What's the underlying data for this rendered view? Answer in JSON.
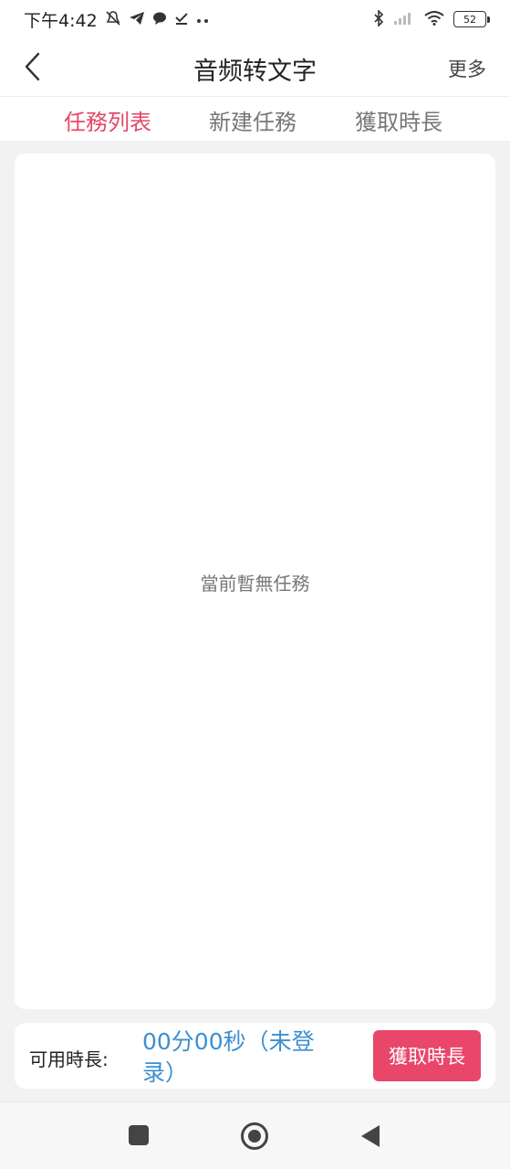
{
  "status_bar": {
    "time": "下午4:42",
    "left_icons": [
      "mute-bell-icon",
      "telegram-icon",
      "chat-icon",
      "download-done-icon",
      "more-dots-icon"
    ],
    "right_icons": [
      "bluetooth-icon",
      "signal-icon",
      "wifi-icon"
    ],
    "battery": "52"
  },
  "header": {
    "title": "音频转文字",
    "more_label": "更多"
  },
  "tabs": [
    {
      "label": "任務列表",
      "active": true
    },
    {
      "label": "新建任務",
      "active": false
    },
    {
      "label": "獲取時長",
      "active": false
    }
  ],
  "task_list": {
    "empty_text": "當前暫無任務"
  },
  "bottom_bar": {
    "available_label": "可用時長:",
    "available_value": "00分00秒（未登录）",
    "get_button_label": "獲取時長"
  },
  "colors": {
    "accent": "#e44766",
    "button": "#e9476a",
    "value_blue": "#3d8fd1",
    "background": "#f2f2f2"
  }
}
